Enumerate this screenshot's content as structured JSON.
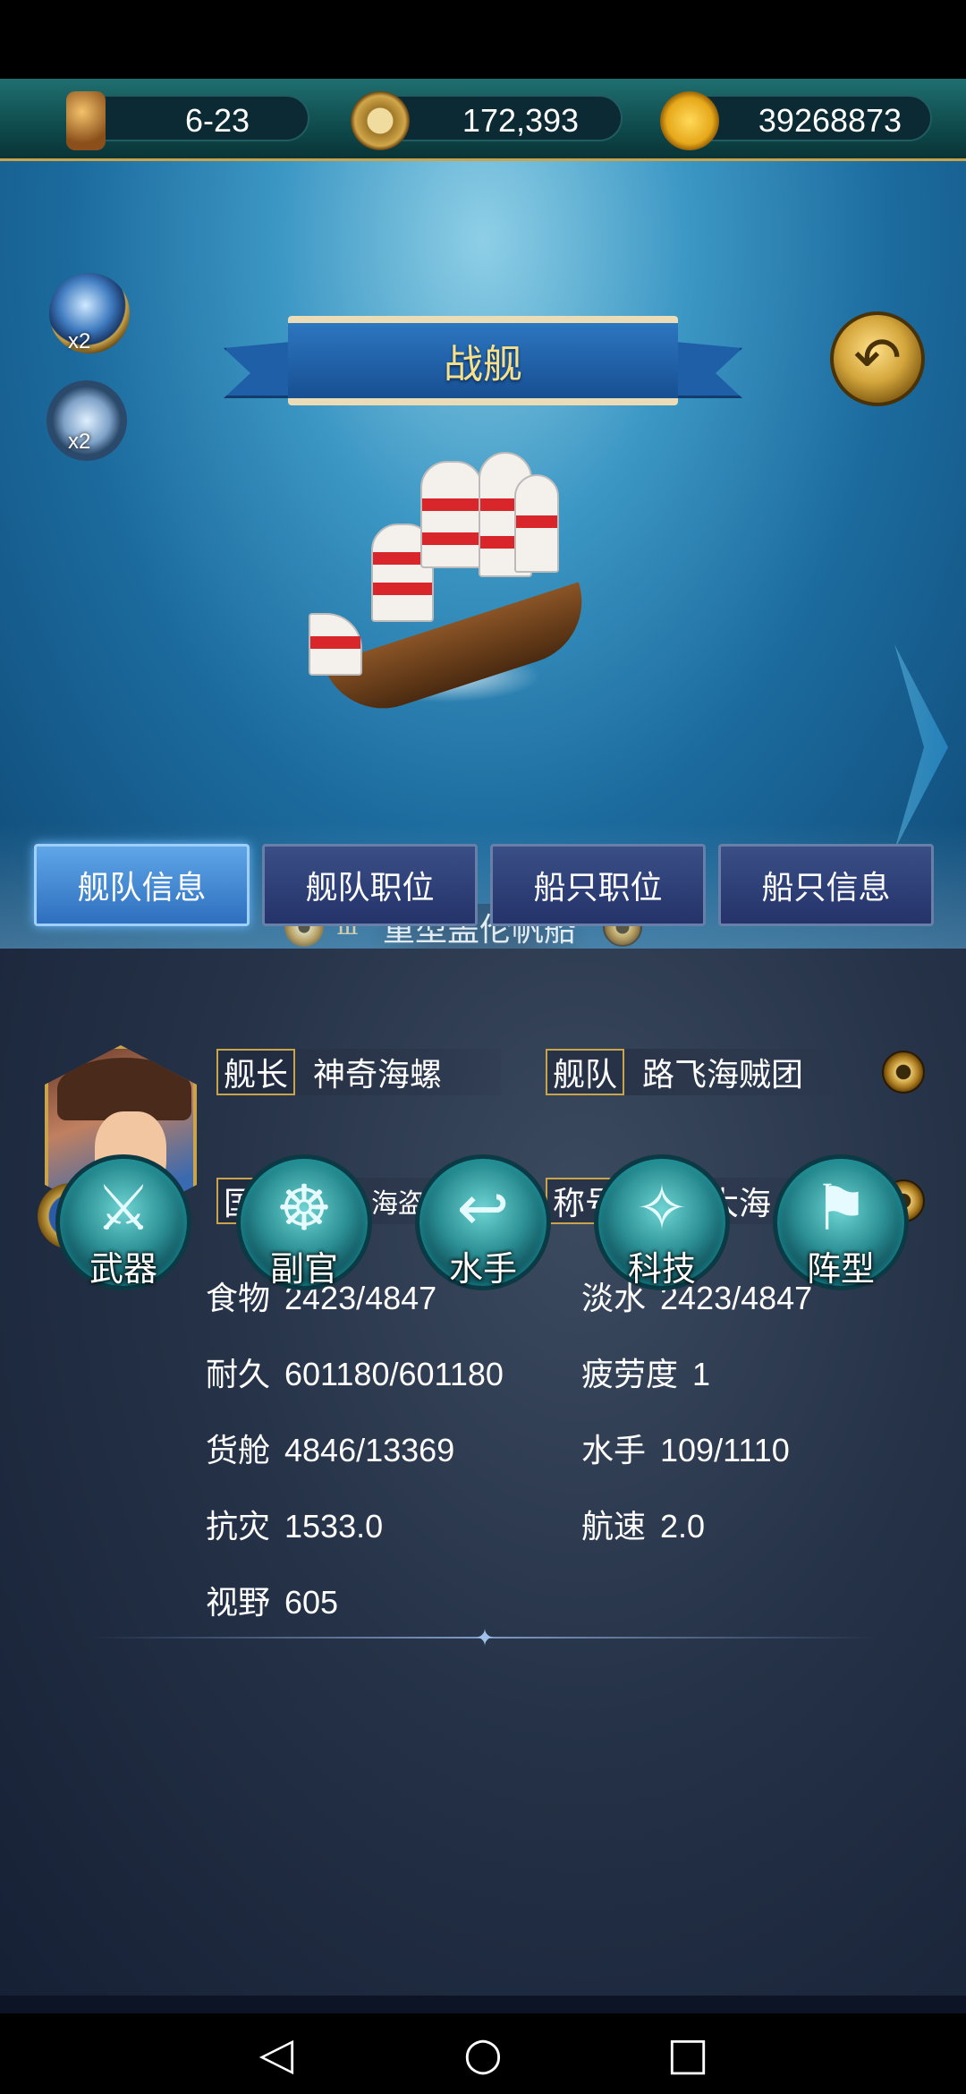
{
  "resources": {
    "date": "6-23",
    "compass_value": "172,393",
    "gold": "39268873"
  },
  "buffs": {
    "search": "x2",
    "swords": "x2"
  },
  "title": "战舰",
  "ship": {
    "tier": "Ⅲ",
    "name": "重型盖伦帆船"
  },
  "tabs": [
    {
      "label": "舰队信息",
      "active": true
    },
    {
      "label": "舰队职位",
      "active": false
    },
    {
      "label": "船只职位",
      "active": false
    },
    {
      "label": "船只信息",
      "active": false
    }
  ],
  "captain": {
    "captain_label": "舰长",
    "captain_name": "神奇海螺",
    "fleet_label": "舰队",
    "fleet_name": "路飞海贼团",
    "nationality_label": "国籍",
    "nationality": "海盗",
    "title_label": "称号",
    "title": "星辰大海"
  },
  "stats": {
    "food_label": "食物",
    "food": "2423/4847",
    "water_label": "淡水",
    "water": "2423/4847",
    "durability_label": "耐久",
    "durability": "601180/601180",
    "fatigue_label": "疲劳度",
    "fatigue": "1",
    "cargo_label": "货舱",
    "cargo": "4846/13369",
    "sailors_label": "水手",
    "sailors": "109/1110",
    "disaster_label": "抗灾",
    "disaster": "1533.0",
    "speed_label": "航速",
    "speed": "2.0",
    "vision_label": "视野",
    "vision": "605"
  },
  "actions": [
    {
      "label": "武器",
      "icon": "sword-icon"
    },
    {
      "label": "副官",
      "icon": "helm-wheel-icon"
    },
    {
      "label": "水手",
      "icon": "hook-icon"
    },
    {
      "label": "科技",
      "icon": "compass-icon"
    },
    {
      "label": "阵型",
      "icon": "flag-icon"
    }
  ],
  "colors": {
    "gold_border": "#c9a44a",
    "tab_active": "#2e6fbe",
    "tab_inactive": "#24336a",
    "action_teal": "#2a8e93"
  }
}
